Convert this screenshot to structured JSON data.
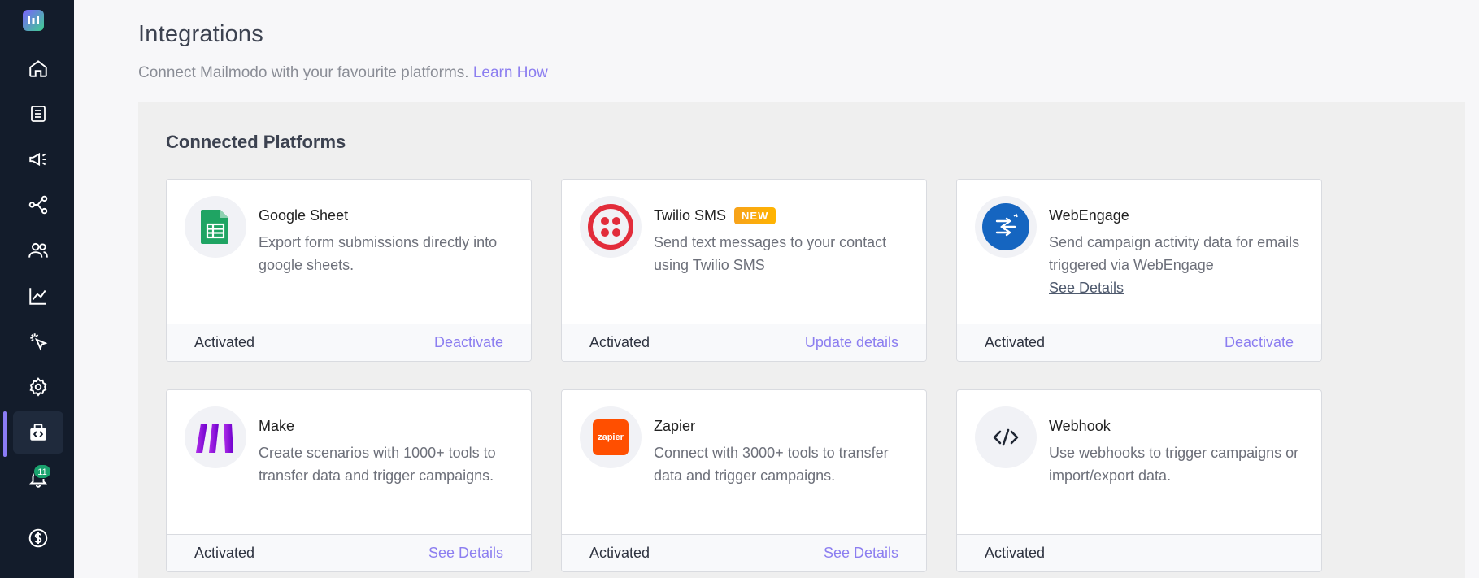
{
  "header": {
    "title": "Integrations",
    "subtitle": "Connect Mailmodo with your favourite platforms.",
    "learn_how": "Learn How"
  },
  "sidebar": {
    "notification_count": "11",
    "active_item": "integrations"
  },
  "colors": {
    "accent": "#8c7ef0",
    "sidebar_bg": "#131c2b",
    "badge_green": "#1aa36e"
  },
  "section": {
    "title": "Connected Platforms"
  },
  "cards": [
    {
      "name": "Google Sheet",
      "desc": "Export form submissions directly into google sheets.",
      "status": "Activated",
      "action": "Deactivate"
    },
    {
      "name": "Twilio SMS",
      "badge": "NEW",
      "desc": "Send text messages to your contact using Twilio SMS",
      "status": "Activated",
      "action": "Update details"
    },
    {
      "name": "WebEngage",
      "desc": "Send campaign activity data for emails triggered via WebEngage",
      "link": "See Details",
      "status": "Activated",
      "action": "Deactivate"
    },
    {
      "name": "Make",
      "desc": "Create scenarios with 1000+ tools to transfer data and trigger campaigns.",
      "status": "Activated",
      "action": "See Details"
    },
    {
      "name": "Zapier",
      "logo_text": "zapier",
      "desc": "Connect with 3000+ tools to transfer data and trigger campaigns.",
      "status": "Activated",
      "action": "See Details"
    },
    {
      "name": "Webhook",
      "desc": "Use webhooks to trigger campaigns or import/export data.",
      "status": "Activated"
    }
  ]
}
